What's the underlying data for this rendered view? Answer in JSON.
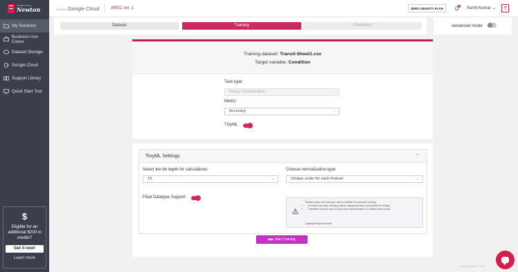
{
  "sidebar": {
    "logo_sub": "Intelligent Agent",
    "logo_name": "Newton",
    "items": [
      {
        "label": "My Solutions",
        "icon": "folder-icon",
        "active": true
      },
      {
        "label": "Business Use Cases",
        "icon": "briefcase-icon"
      },
      {
        "label": "Dataset Storage",
        "icon": "storage-icon"
      },
      {
        "label": "Google Cloud",
        "icon": "cloud-icon"
      },
      {
        "label": "Support Library",
        "icon": "book-icon"
      },
      {
        "label": "Quick Start Tour",
        "icon": "monitor-icon"
      }
    ],
    "promo": {
      "icon": "$",
      "text": "Eligible for an additional $200 in credits?",
      "button": "Get it now!",
      "link": "Learn more"
    }
  },
  "topbar": {
    "powered_by": "Powered",
    "cloud_name": "Google Cloud",
    "project": "AREC ver. 1",
    "plan_button": "ZERO GRAVITY PLAN",
    "notification_count": "1",
    "user_name": "Sumit Kumar",
    "help": "?"
  },
  "steps": {
    "dataset": "Dataset",
    "training": "Training",
    "prediction": "Prediction"
  },
  "advanced_mode": {
    "label": "Advanced mode",
    "enabled": false
  },
  "training": {
    "dataset_prefix": "Training dataset:",
    "dataset_name": "Transit-Sheet1.csv",
    "target_prefix": "Target variable:",
    "target_name": "Condition",
    "task_type_label": "Task type:",
    "task_type_value": "Binary Classification",
    "metric_label": "Metric:",
    "metric_value": "Accuracy",
    "tinyml_label": "TinyML",
    "tinyml_enabled": true
  },
  "tinyml_settings": {
    "title": "TinyML Settings",
    "bit_depth_label": "Select the bit depth for calculations:",
    "bit_depth_value": "16",
    "normalization_label": "Choose normalization type:",
    "normalization_value": "Unique scale for each feature",
    "float_label": "Float Datatype Support",
    "float_enabled": true,
    "info_intro": "Please make sure that your data is suitable for machine learning:",
    "info_items": [
      "Excludes text data, missing values categorical data represented as strings",
      "Date/time columns are in epoch time representation or relative date format"
    ],
    "info_link": "Dataset Requirements"
  },
  "start_button": "Start Training",
  "footer": "AutoIntegrator © 2022",
  "colors": {
    "accent": "#cc2a5c",
    "start_button": "#c830c8",
    "sidebar": "#3a3f4b"
  }
}
